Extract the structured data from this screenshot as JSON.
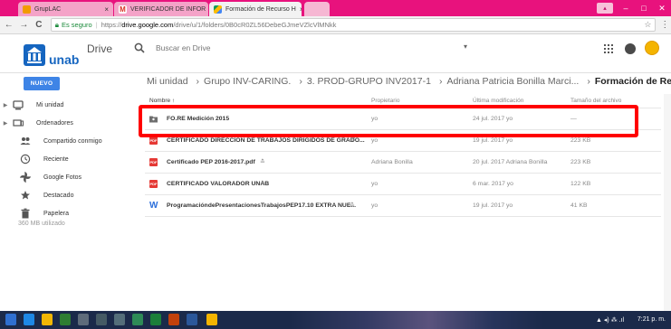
{
  "browser": {
    "tabs": [
      {
        "label": "GrupLAC",
        "close": "×"
      },
      {
        "label": "VERIFICADOR DE INFOR",
        "close": "×"
      },
      {
        "label": "Formación de Recurso H",
        "close": "×"
      }
    ],
    "address": {
      "security_label": "Es seguro",
      "scheme": "https://",
      "host": "drive.google.com",
      "path": "/drive/u/1/folders/0B0cR0ZL56DebeGJmeVZlcVlMNkk"
    },
    "nav": {
      "back": "←",
      "forward": "→",
      "reload": "C"
    },
    "star": "☆",
    "menu": "⋮",
    "window": {
      "minimize": "–",
      "maximize": "□",
      "close": "✕"
    }
  },
  "drive": {
    "logo_text": "unab",
    "title": "Drive",
    "search_placeholder": "Buscar en Drive",
    "new_button": "NUEVO",
    "breadcrumb": [
      "Mi unidad",
      "Grupo INV-CARING.",
      "3. PROD-GRUPO INV2017-1",
      "Adriana Patricia Bonilla Marci..."
    ],
    "breadcrumb_current": "Formación de Recur"
  },
  "sidebar": {
    "items": [
      {
        "label": "Mi unidad",
        "icon": "drive-icon",
        "expandable": true
      },
      {
        "label": "Ordenadores",
        "icon": "computer-icon",
        "expandable": true
      },
      {
        "label": "Compartido conmigo",
        "icon": "people-icon",
        "expandable": false
      },
      {
        "label": "Reciente",
        "icon": "clock-icon",
        "expandable": false
      },
      {
        "label": "Google Fotos",
        "icon": "pinwheel-icon",
        "expandable": false
      },
      {
        "label": "Destacado",
        "icon": "star-icon",
        "expandable": false
      },
      {
        "label": "Papelera",
        "icon": "trash-icon",
        "expandable": false
      }
    ],
    "storage": "360 MB utilizado"
  },
  "filelist": {
    "columns": {
      "name": "Nombre ↑",
      "owner": "Propietario",
      "modified": "Última modificación",
      "size": "Tamaño del archivo"
    },
    "rows": [
      {
        "type": "folder",
        "name": "FO.RE Medición 2015",
        "shared": false,
        "owner": "yo",
        "modified": "24 jul. 2017 yo",
        "size": "—"
      },
      {
        "type": "pdf",
        "name": "CERTIFICADO DIRECCIÓN DE TRABAJOS DIRIGIDOS DE GRADO...",
        "shared": true,
        "owner": "yo",
        "modified": "19 jul. 2017 yo",
        "size": "223 KB"
      },
      {
        "type": "pdf",
        "name": "Certificado PEP 2016-2017.pdf",
        "shared": true,
        "owner": "Adriana Bonilla",
        "modified": "20 jul. 2017 Adriana Bonilla",
        "size": "223 KB"
      },
      {
        "type": "pdf",
        "name": "CERTIFICADO VALORADOR UNAB",
        "shared": true,
        "owner": "yo",
        "modified": "6 mar. 2017 yo",
        "size": "122 KB"
      },
      {
        "type": "word",
        "name": "ProgramacióndePresentacionesTrabajosPEP17.10 EXTRA NUE...",
        "shared": true,
        "owner": "yo",
        "modified": "19 jul. 2017 yo",
        "size": "41 KB"
      }
    ],
    "shared_glyph": "≛"
  },
  "taskbar": {
    "clock": "7:21 p. m.",
    "tray": "▲ ◂) ⁂ .ıl"
  },
  "colors": {
    "chrome_accent": "#e8127d",
    "drive_blue": "#3e84e6",
    "highlight": "#ff0000",
    "pdf_red": "#e53935"
  }
}
